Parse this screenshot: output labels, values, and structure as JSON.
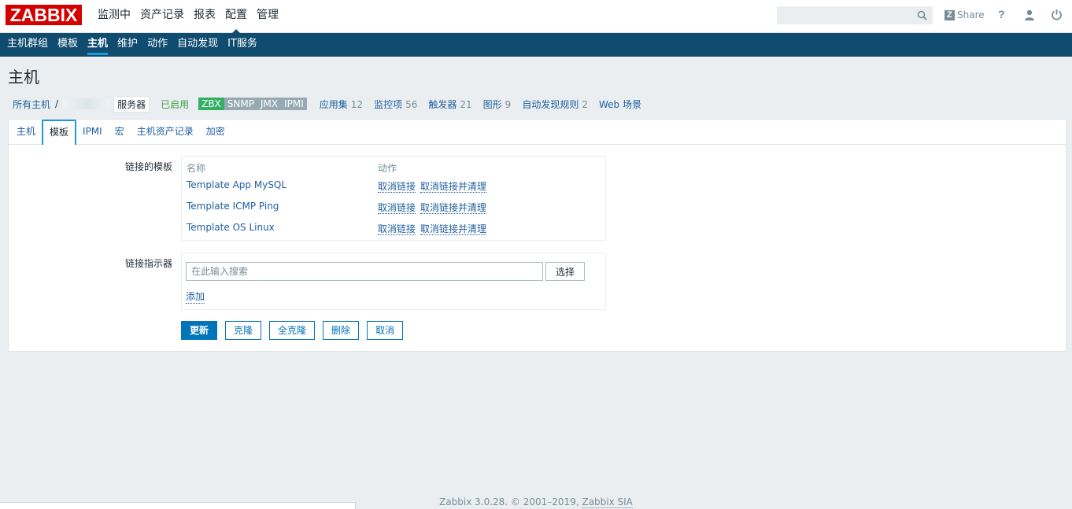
{
  "header": {
    "logo": "ZABBIX",
    "nav": [
      {
        "label": "监测中",
        "active": false
      },
      {
        "label": "资产记录",
        "active": false
      },
      {
        "label": "报表",
        "active": false
      },
      {
        "label": "配置",
        "active": true
      },
      {
        "label": "管理",
        "active": false
      }
    ],
    "search_value": "",
    "share_label": "Share",
    "help_label": "?"
  },
  "subnav": [
    {
      "label": "主机群组",
      "active": false
    },
    {
      "label": "模板",
      "active": false
    },
    {
      "label": "主机",
      "active": true
    },
    {
      "label": "维护",
      "active": false
    },
    {
      "label": "动作",
      "active": false
    },
    {
      "label": "自动发现",
      "active": false
    },
    {
      "label": "IT服务",
      "active": false
    }
  ],
  "page_title": "主机",
  "hostnav": {
    "all_hosts": "所有主机",
    "separator": "/",
    "host_name": "服务器",
    "status": "已启用",
    "availability": [
      "ZBX",
      "SNMP",
      "JMX",
      "IPMI"
    ],
    "links": [
      {
        "label": "应用集",
        "count": "12"
      },
      {
        "label": "监控项",
        "count": "56"
      },
      {
        "label": "触发器",
        "count": "21"
      },
      {
        "label": "图形",
        "count": "9"
      },
      {
        "label": "自动发现规则",
        "count": "2"
      },
      {
        "label": "Web 场景",
        "count": ""
      }
    ]
  },
  "tabs": [
    {
      "label": "主机",
      "active": false
    },
    {
      "label": "模板",
      "active": true
    },
    {
      "label": "IPMI",
      "active": false
    },
    {
      "label": "宏",
      "active": false
    },
    {
      "label": "主机资产记录",
      "active": false
    },
    {
      "label": "加密",
      "active": false
    }
  ],
  "form": {
    "linked_label": "链接的模板",
    "col_name": "名称",
    "col_action": "动作",
    "templates": [
      {
        "name": "Template App MySQL",
        "unlink": "取消链接",
        "unlink_clear": "取消链接并清理"
      },
      {
        "name": "Template ICMP Ping",
        "unlink": "取消链接",
        "unlink_clear": "取消链接并清理"
      },
      {
        "name": "Template OS Linux",
        "unlink": "取消链接",
        "unlink_clear": "取消链接并清理"
      }
    ],
    "indicator_label": "链接指示器",
    "search_placeholder": "在此输入搜索",
    "select_label": "选择",
    "add_label": "添加"
  },
  "buttons": {
    "update": "更新",
    "clone": "克隆",
    "full_clone": "全克隆",
    "delete": "删除",
    "cancel": "取消"
  },
  "footer": {
    "text": "Zabbix 3.0.28. © 2001–2019,",
    "link": "Zabbix SIA"
  },
  "colors": {
    "brand_red": "#d40000",
    "subnav_bg": "#0f4c6f",
    "primary_blue": "#0275b8",
    "enabled_green": "#429e47",
    "zbx_green": "#34af67"
  }
}
